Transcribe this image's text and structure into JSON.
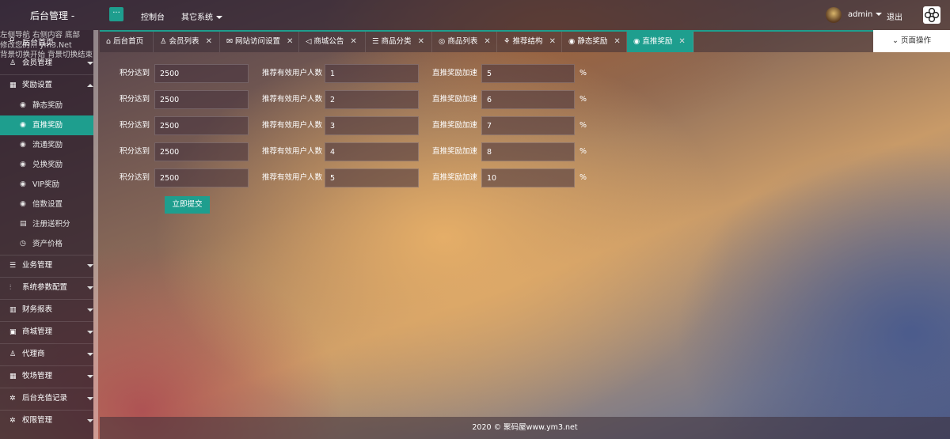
{
  "header": {
    "brand": "后台管理 -",
    "menu_toggle": "···",
    "nav": [
      "控制台",
      "其它系统"
    ],
    "user": "admin",
    "logout": "退出"
  },
  "sidebar": {
    "overlay_lines": [
      "左侧导航 右侧内容 底部",
      "修改您的... ym3.Net",
      "背景切换开始 背景切换结束"
    ],
    "home": "后台首页",
    "items_top": [
      {
        "label": "会员管理",
        "icon": "user-icon"
      },
      {
        "label": "奖励设置",
        "icon": "gift-icon"
      }
    ],
    "sub_items": [
      {
        "label": "静态奖励",
        "icon": "circle-dot-icon",
        "active": false
      },
      {
        "label": "直推奖励",
        "icon": "circle-dot-icon",
        "active": true
      },
      {
        "label": "流通奖励",
        "icon": "circle-dot-icon",
        "active": false
      },
      {
        "label": "兑换奖励",
        "icon": "circle-dot-icon",
        "active": false
      },
      {
        "label": "VIP奖励",
        "icon": "circle-dot-icon",
        "active": false
      },
      {
        "label": "倍数设置",
        "icon": "circle-dot-icon",
        "active": false
      },
      {
        "label": "注册送积分",
        "icon": "coins-icon",
        "active": false
      },
      {
        "label": "资产价格",
        "icon": "price-icon",
        "active": false
      }
    ],
    "items_bottom": [
      {
        "label": "业务管理",
        "icon": "list-icon"
      },
      {
        "label": "系统参数配置",
        "icon": "sliders-icon"
      },
      {
        "label": "财务报表",
        "icon": "chart-icon"
      },
      {
        "label": "商城管理",
        "icon": "shop-icon"
      },
      {
        "label": "代理商",
        "icon": "user-icon"
      },
      {
        "label": "牧场管理",
        "icon": "gift-icon"
      },
      {
        "label": "后台充值记录",
        "icon": "gear-icon"
      },
      {
        "label": "权限管理",
        "icon": "gear-icon"
      }
    ]
  },
  "tabs": [
    {
      "label": "后台首页",
      "icon": "home-icon",
      "closable": false
    },
    {
      "label": "会员列表",
      "icon": "user-icon",
      "closable": true
    },
    {
      "label": "网站访问设置",
      "icon": "mail-icon",
      "closable": true
    },
    {
      "label": "商城公告",
      "icon": "speaker-icon",
      "closable": true
    },
    {
      "label": "商品分类",
      "icon": "list-icon",
      "closable": true
    },
    {
      "label": "商品列表",
      "icon": "circle-icon",
      "closable": true
    },
    {
      "label": "推荐结构",
      "icon": "tree-icon",
      "closable": true
    },
    {
      "label": "静态奖励",
      "icon": "circle-dot-icon",
      "closable": true
    },
    {
      "label": "直推奖励",
      "icon": "circle-dot-icon",
      "closable": true,
      "active": true
    }
  ],
  "page_ops": "页面操作",
  "form": {
    "label_points": "积分达到",
    "label_users": "推荐有效用户人数",
    "label_speed": "直推奖励加速",
    "unit": "%",
    "rows": [
      {
        "points": "2500",
        "users": "1",
        "speed": "5"
      },
      {
        "points": "2500",
        "users": "2",
        "speed": "6"
      },
      {
        "points": "2500",
        "users": "3",
        "speed": "7"
      },
      {
        "points": "2500",
        "users": "4",
        "speed": "8"
      },
      {
        "points": "2500",
        "users": "5",
        "speed": "10"
      }
    ],
    "submit": "立即提交"
  },
  "footer": "2020 © 聚码屋www.ym3.net",
  "colors": {
    "accent": "#1e9e8e"
  }
}
